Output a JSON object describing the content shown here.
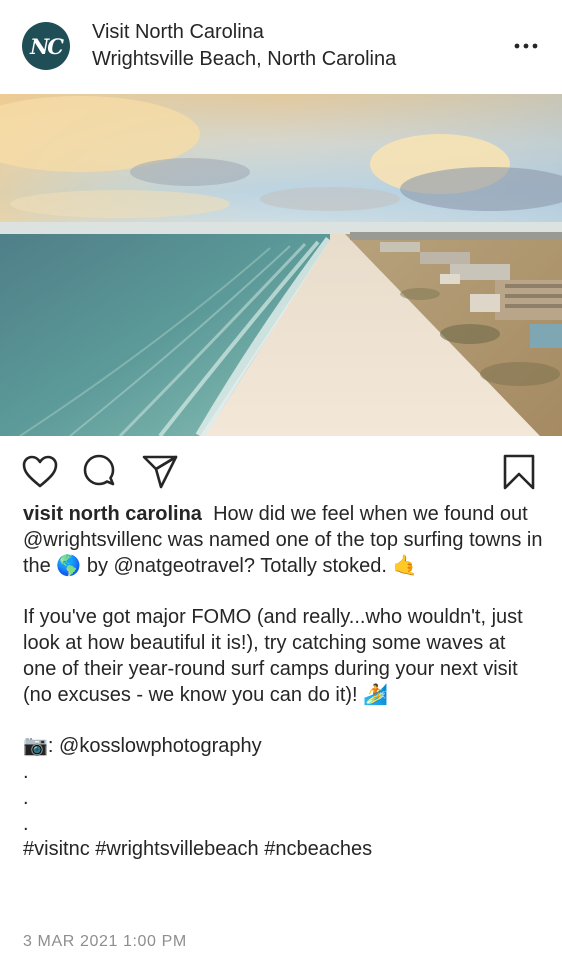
{
  "header": {
    "avatar_text": "NC",
    "account_name": "Visit North Carolina",
    "location": "Wrightsville Beach, North Carolina",
    "more_icon": "more-horizontal-icon"
  },
  "post": {
    "image_description": "beach-aerial-photo"
  },
  "actions": {
    "like_icon": "heart-icon",
    "comment_icon": "comment-icon",
    "share_icon": "paper-plane-icon",
    "save_icon": "bookmark-icon"
  },
  "caption": {
    "author": "visit north carolina",
    "line1": "How did we feel when we found out @wrightsvillenc was named one of the top surfing towns in the 🌎 by @natgeotravel? Totally stoked. 🤙",
    "line2": "If you've got major FOMO (and really...who wouldn't, just look at how beautiful it is!), try catching some waves at one of their year-round surf camps during your next visit (no excuses - we know you can do it)! 🏄",
    "photo_credit": "📷: @kosslowphotography",
    "dots": [
      ".",
      ".",
      "."
    ],
    "hashtags": "#visitnc #wrightsvillebeach #ncbeaches"
  },
  "timestamp": "3 MAR 2021 1:00 PM"
}
